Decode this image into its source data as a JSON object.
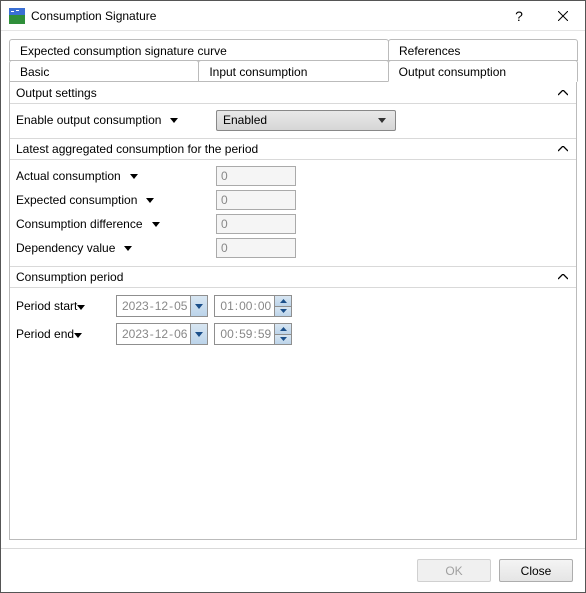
{
  "titlebar": {
    "title": "Consumption Signature",
    "help_tooltip": "Help",
    "close_tooltip": "Close"
  },
  "tabs_top": [
    {
      "label": "Expected consumption signature curve"
    },
    {
      "label": "References"
    }
  ],
  "tabs_bottom": [
    {
      "label": "Basic"
    },
    {
      "label": "Input consumption"
    },
    {
      "label": "Output consumption"
    }
  ],
  "groups": {
    "output_settings": {
      "title": "Output settings",
      "enable_label": "Enable output consumption",
      "enable_value": "Enabled"
    },
    "latest_agg": {
      "title": "Latest aggregated consumption for the period",
      "actual_label": "Actual consumption",
      "actual_value": "0",
      "expected_label": "Expected consumption",
      "expected_value": "0",
      "diff_label": "Consumption difference",
      "diff_value": "0",
      "dep_label": "Dependency value",
      "dep_value": "0"
    },
    "period": {
      "title": "Consumption period",
      "start_label": "Period start",
      "start_date_y": "2023",
      "start_date_m": "12",
      "start_date_d": "05",
      "start_time_h": "01",
      "start_time_m": "00",
      "start_time_s": "00",
      "end_label": "Period end",
      "end_date_y": "2023",
      "end_date_m": "12",
      "end_date_d": "06",
      "end_time_h": "00",
      "end_time_m": "59",
      "end_time_s": "59"
    }
  },
  "buttons": {
    "ok": "OK",
    "close": "Close"
  }
}
